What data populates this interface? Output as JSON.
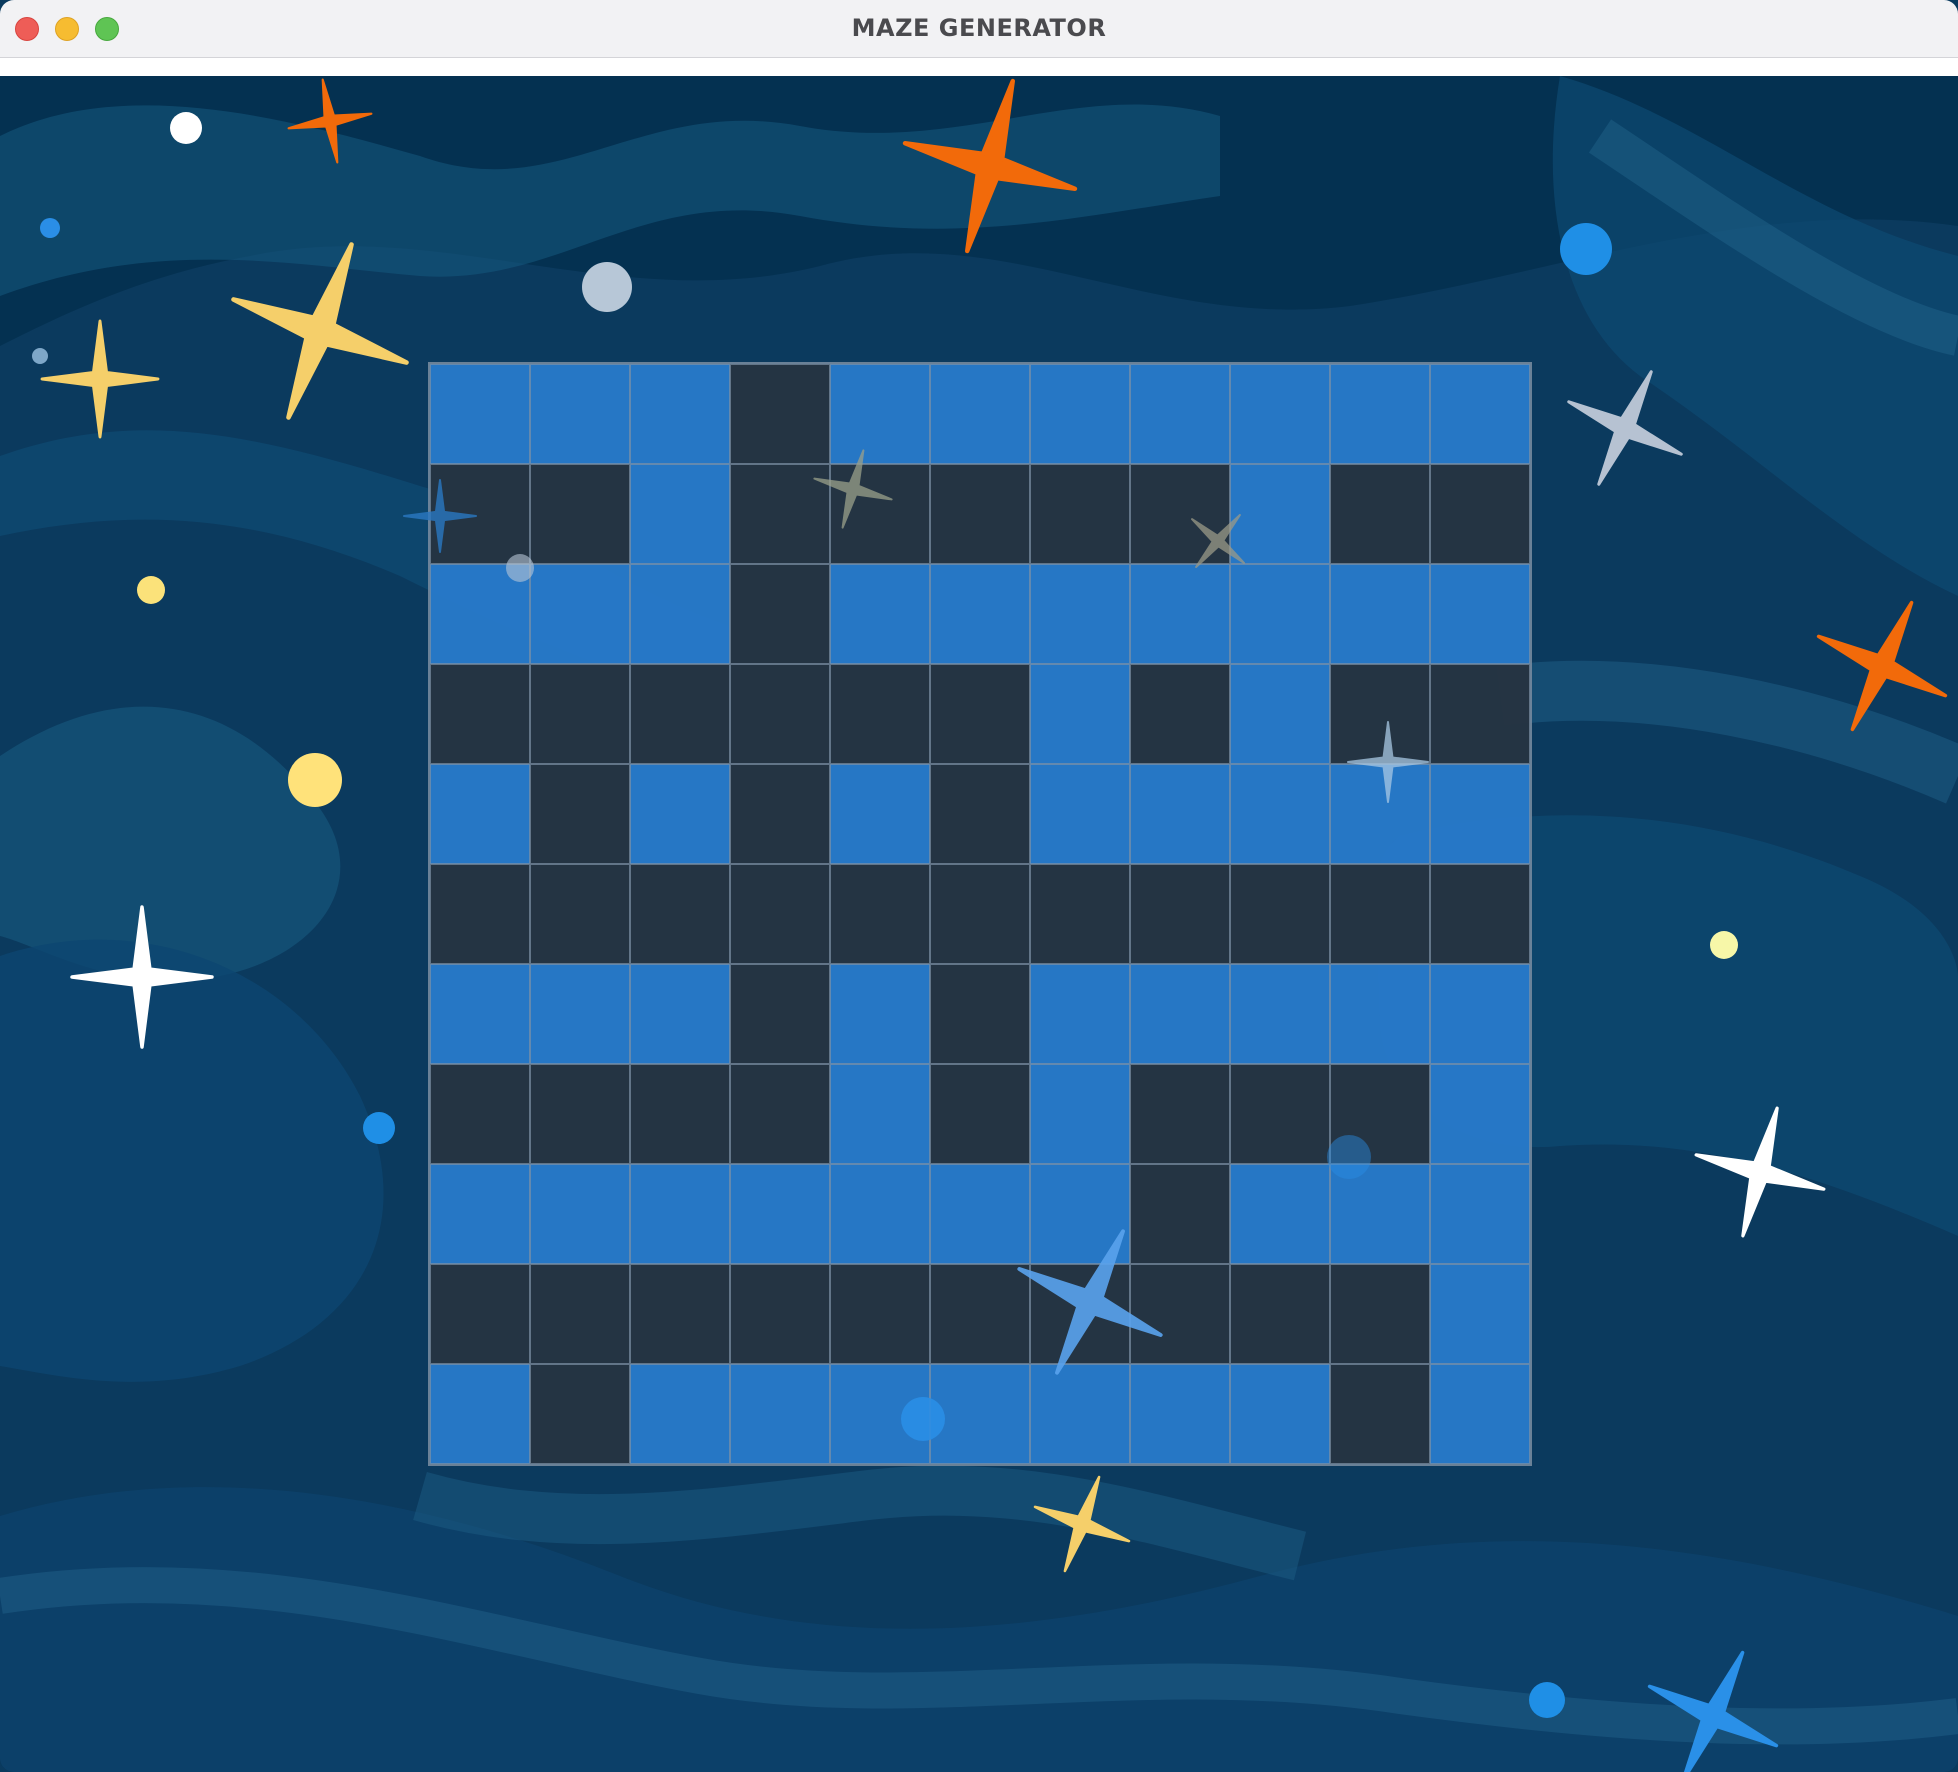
{
  "window": {
    "title": "MAZE GENERATOR",
    "controls": [
      "close-button",
      "minimize-button",
      "zoom-button"
    ]
  },
  "colors": {
    "background": "#0a3a5e",
    "path_cell": "#227ad2",
    "wall_cell": "#22303e",
    "star_orange": "#f26a0a",
    "star_yellow": "#f5cf6a",
    "star_white": "#ffffff",
    "star_blue": "#2a90e8",
    "star_gray": "#b6c2d2"
  },
  "maze": {
    "rows": 11,
    "cols": 11,
    "cells": [
      "...#.......",
      "##.#####.##",
      "...#.......",
      "######.#.##",
      ".#.#.#.....",
      "###########",
      "...#.#.....",
      "####.#.###.",
      ".......#...",
      "##########.",
      ".#.......#."
    ]
  }
}
